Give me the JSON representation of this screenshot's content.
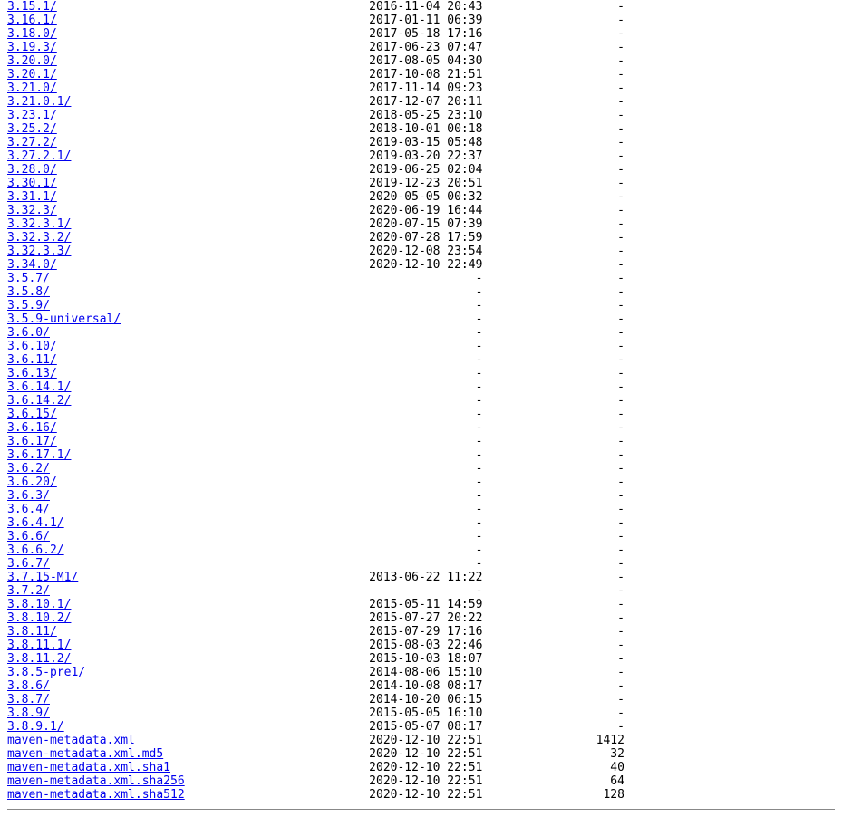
{
  "entries": [
    {
      "name": "3.15.1/",
      "date": "2016-11-04 20:43",
      "size": "-"
    },
    {
      "name": "3.16.1/",
      "date": "2017-01-11 06:39",
      "size": "-"
    },
    {
      "name": "3.18.0/",
      "date": "2017-05-18 17:16",
      "size": "-"
    },
    {
      "name": "3.19.3/",
      "date": "2017-06-23 07:47",
      "size": "-"
    },
    {
      "name": "3.20.0/",
      "date": "2017-08-05 04:30",
      "size": "-"
    },
    {
      "name": "3.20.1/",
      "date": "2017-10-08 21:51",
      "size": "-"
    },
    {
      "name": "3.21.0/",
      "date": "2017-11-14 09:23",
      "size": "-"
    },
    {
      "name": "3.21.0.1/",
      "date": "2017-12-07 20:11",
      "size": "-"
    },
    {
      "name": "3.23.1/",
      "date": "2018-05-25 23:10",
      "size": "-"
    },
    {
      "name": "3.25.2/",
      "date": "2018-10-01 00:18",
      "size": "-"
    },
    {
      "name": "3.27.2/",
      "date": "2019-03-15 05:48",
      "size": "-"
    },
    {
      "name": "3.27.2.1/",
      "date": "2019-03-20 22:37",
      "size": "-"
    },
    {
      "name": "3.28.0/",
      "date": "2019-06-25 02:04",
      "size": "-"
    },
    {
      "name": "3.30.1/",
      "date": "2019-12-23 20:51",
      "size": "-"
    },
    {
      "name": "3.31.1/",
      "date": "2020-05-05 00:32",
      "size": "-"
    },
    {
      "name": "3.32.3/",
      "date": "2020-06-19 16:44",
      "size": "-"
    },
    {
      "name": "3.32.3.1/",
      "date": "2020-07-15 07:39",
      "size": "-"
    },
    {
      "name": "3.32.3.2/",
      "date": "2020-07-28 17:59",
      "size": "-"
    },
    {
      "name": "3.32.3.3/",
      "date": "2020-12-08 23:54",
      "size": "-"
    },
    {
      "name": "3.34.0/",
      "date": "2020-12-10 22:49",
      "size": "-"
    },
    {
      "name": "3.5.7/",
      "date": "",
      "size": "-",
      "emptydate": true
    },
    {
      "name": "3.5.8/",
      "date": "",
      "size": "-",
      "emptydate": true
    },
    {
      "name": "3.5.9/",
      "date": "",
      "size": "-",
      "emptydate": true
    },
    {
      "name": "3.5.9-universal/",
      "date": "",
      "size": "-",
      "emptydate": true
    },
    {
      "name": "3.6.0/",
      "date": "",
      "size": "-",
      "emptydate": true
    },
    {
      "name": "3.6.10/",
      "date": "",
      "size": "-",
      "emptydate": true
    },
    {
      "name": "3.6.11/",
      "date": "",
      "size": "-",
      "emptydate": true
    },
    {
      "name": "3.6.13/",
      "date": "",
      "size": "-",
      "emptydate": true
    },
    {
      "name": "3.6.14.1/",
      "date": "",
      "size": "-",
      "emptydate": true
    },
    {
      "name": "3.6.14.2/",
      "date": "",
      "size": "-",
      "emptydate": true
    },
    {
      "name": "3.6.15/",
      "date": "",
      "size": "-",
      "emptydate": true
    },
    {
      "name": "3.6.16/",
      "date": "",
      "size": "-",
      "emptydate": true
    },
    {
      "name": "3.6.17/",
      "date": "",
      "size": "-",
      "emptydate": true
    },
    {
      "name": "3.6.17.1/",
      "date": "",
      "size": "-",
      "emptydate": true
    },
    {
      "name": "3.6.2/",
      "date": "",
      "size": "-",
      "emptydate": true
    },
    {
      "name": "3.6.20/",
      "date": "",
      "size": "-",
      "emptydate": true
    },
    {
      "name": "3.6.3/",
      "date": "",
      "size": "-",
      "emptydate": true
    },
    {
      "name": "3.6.4/",
      "date": "",
      "size": "-",
      "emptydate": true
    },
    {
      "name": "3.6.4.1/",
      "date": "",
      "size": "-",
      "emptydate": true
    },
    {
      "name": "3.6.6/",
      "date": "",
      "size": "-",
      "emptydate": true
    },
    {
      "name": "3.6.6.2/",
      "date": "",
      "size": "-",
      "emptydate": true
    },
    {
      "name": "3.6.7/",
      "date": "",
      "size": "-",
      "emptydate": true
    },
    {
      "name": "3.7.15-M1/",
      "date": "2013-06-22 11:22",
      "size": "-"
    },
    {
      "name": "3.7.2/",
      "date": "",
      "size": "-",
      "emptydate": true
    },
    {
      "name": "3.8.10.1/",
      "date": "2015-05-11 14:59",
      "size": "-"
    },
    {
      "name": "3.8.10.2/",
      "date": "2015-07-27 20:22",
      "size": "-"
    },
    {
      "name": "3.8.11/",
      "date": "2015-07-29 17:16",
      "size": "-"
    },
    {
      "name": "3.8.11.1/",
      "date": "2015-08-03 22:46",
      "size": "-"
    },
    {
      "name": "3.8.11.2/",
      "date": "2015-10-03 18:07",
      "size": "-"
    },
    {
      "name": "3.8.5-pre1/",
      "date": "2014-08-06 15:10",
      "size": "-"
    },
    {
      "name": "3.8.6/",
      "date": "2014-10-08 08:17",
      "size": "-"
    },
    {
      "name": "3.8.7/",
      "date": "2014-10-20 06:15",
      "size": "-"
    },
    {
      "name": "3.8.9/",
      "date": "2015-05-05 16:10",
      "size": "-"
    },
    {
      "name": "3.8.9.1/",
      "date": "2015-05-07 08:17",
      "size": "-"
    },
    {
      "name": "maven-metadata.xml",
      "date": "2020-12-10 22:51",
      "size": "1412"
    },
    {
      "name": "maven-metadata.xml.md5",
      "date": "2020-12-10 22:51",
      "size": "32"
    },
    {
      "name": "maven-metadata.xml.sha1",
      "date": "2020-12-10 22:51",
      "size": "40"
    },
    {
      "name": "maven-metadata.xml.sha256",
      "date": "2020-12-10 22:51",
      "size": "64"
    },
    {
      "name": "maven-metadata.xml.sha512",
      "date": "2020-12-10 22:51",
      "size": "128"
    }
  ],
  "layout": {
    "nameCol": 51,
    "dateCol": 17,
    "sizeCol": 19
  }
}
